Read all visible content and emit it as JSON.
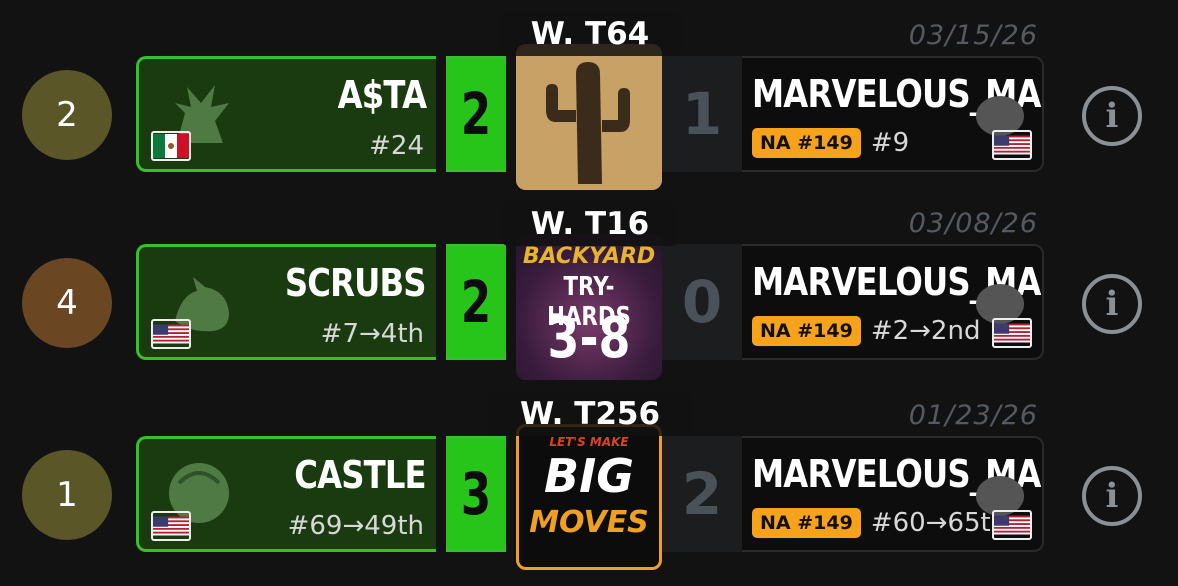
{
  "matches": [
    {
      "date": "03/15/26",
      "placement": "2",
      "placement_color": "#5a5628",
      "tournament_label": "W. T64",
      "tournament_art": "cactus-art",
      "left": {
        "name": "A$TA",
        "seed": "#24",
        "score": "2",
        "flag": "mexico-flag"
      },
      "right": {
        "name": "MARVELOUS_MA...",
        "tag": "NA #149",
        "seed": "#9",
        "score": "1",
        "flag": "usa-flag"
      }
    },
    {
      "date": "03/08/26",
      "placement": "4",
      "placement_color": "#6b4623",
      "tournament_label": "W. T16",
      "tournament_art": "backyard-try-hards-art",
      "art_text": {
        "line1": "BACKYARD",
        "line2": "TRY-HARDS",
        "line3": "3-8"
      },
      "left": {
        "name": "SCRUBS",
        "seed": "#7→4th",
        "score": "2",
        "flag": "usa-flag"
      },
      "right": {
        "name": "MARVELOUS_MA...",
        "tag": "NA #149",
        "seed": "#2→2nd",
        "score": "0",
        "flag": "usa-flag"
      }
    },
    {
      "date": "01/23/26",
      "placement": "1",
      "placement_color": "#5a5628",
      "tournament_label": "W. T256",
      "tournament_art": "big-moves-art",
      "art_text": {
        "line1": "LET'S MAKE",
        "line2": "BIG",
        "line3": "MOVES"
      },
      "left": {
        "name": "CASTLE",
        "seed": "#69→49th",
        "score": "3",
        "flag": "usa-flag"
      },
      "right": {
        "name": "MARVELOUS_MA...",
        "tag": "NA #149",
        "seed": "#60→65th",
        "score": "2",
        "flag": "usa-flag"
      }
    }
  ],
  "colors": {
    "win_green": "#27c41a",
    "tag_orange": "#f6a21b"
  }
}
